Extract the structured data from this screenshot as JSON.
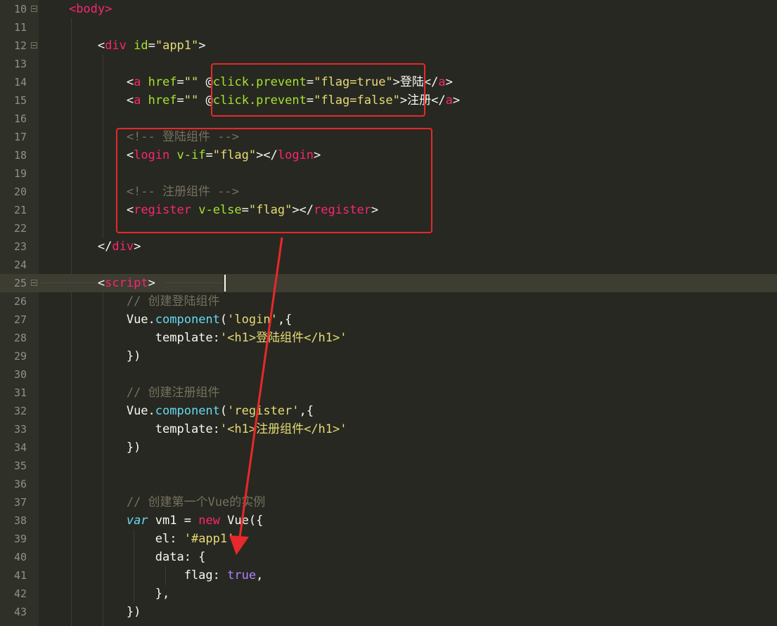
{
  "editor": {
    "lines": [
      {
        "n": "10",
        "fold": "open",
        "indent": "    ",
        "tokens": [
          [
            "tag",
            "<body>"
          ]
        ]
      },
      {
        "n": "11",
        "indent": "",
        "tokens": []
      },
      {
        "n": "12",
        "fold": "open",
        "indent": "        ",
        "tokens": [
          [
            "txt",
            "<"
          ],
          [
            "tag",
            "div"
          ],
          [
            "txt",
            " "
          ],
          [
            "attr",
            "id"
          ],
          [
            "txt",
            "="
          ],
          [
            "str",
            "\"app1\""
          ],
          [
            "txt",
            ">"
          ]
        ]
      },
      {
        "n": "13",
        "indent": "",
        "tokens": []
      },
      {
        "n": "14",
        "indent": "            ",
        "tokens": [
          [
            "txt",
            "<"
          ],
          [
            "tag",
            "a"
          ],
          [
            "txt",
            " "
          ],
          [
            "attr",
            "href"
          ],
          [
            "txt",
            "="
          ],
          [
            "str",
            "\"\""
          ],
          [
            "txt",
            " "
          ],
          [
            "txt",
            "@"
          ],
          [
            "attr",
            "click.prevent"
          ],
          [
            "txt",
            "="
          ],
          [
            "str",
            "\"flag=true\""
          ],
          [
            "txt",
            ">登陆</"
          ],
          [
            "tag",
            "a"
          ],
          [
            "txt",
            ">"
          ]
        ]
      },
      {
        "n": "15",
        "indent": "            ",
        "tokens": [
          [
            "txt",
            "<"
          ],
          [
            "tag",
            "a"
          ],
          [
            "txt",
            " "
          ],
          [
            "attr",
            "href"
          ],
          [
            "txt",
            "="
          ],
          [
            "str",
            "\"\""
          ],
          [
            "txt",
            " "
          ],
          [
            "txt",
            "@"
          ],
          [
            "attr",
            "click.prevent"
          ],
          [
            "txt",
            "="
          ],
          [
            "str",
            "\"flag=false\""
          ],
          [
            "txt",
            ">注册</"
          ],
          [
            "tag",
            "a"
          ],
          [
            "txt",
            ">"
          ]
        ]
      },
      {
        "n": "16",
        "indent": "",
        "tokens": []
      },
      {
        "n": "17",
        "indent": "            ",
        "tokens": [
          [
            "cmt",
            "<!-- 登陆组件 -->"
          ]
        ]
      },
      {
        "n": "18",
        "indent": "            ",
        "tokens": [
          [
            "txt",
            "<"
          ],
          [
            "tag",
            "login"
          ],
          [
            "txt",
            " "
          ],
          [
            "attr",
            "v-if"
          ],
          [
            "txt",
            "="
          ],
          [
            "str",
            "\"flag\""
          ],
          [
            "txt",
            "></"
          ],
          [
            "tag",
            "login"
          ],
          [
            "txt",
            ">"
          ]
        ]
      },
      {
        "n": "19",
        "indent": "",
        "tokens": []
      },
      {
        "n": "20",
        "indent": "            ",
        "tokens": [
          [
            "cmt",
            "<!-- 注册组件 -->"
          ]
        ]
      },
      {
        "n": "21",
        "indent": "            ",
        "tokens": [
          [
            "txt",
            "<"
          ],
          [
            "tag",
            "register"
          ],
          [
            "txt",
            " "
          ],
          [
            "attr",
            "v-else"
          ],
          [
            "txt",
            "="
          ],
          [
            "str",
            "\"flag\""
          ],
          [
            "txt",
            "></"
          ],
          [
            "tag",
            "register"
          ],
          [
            "txt",
            ">"
          ]
        ]
      },
      {
        "n": "22",
        "indent": "",
        "tokens": []
      },
      {
        "n": "23",
        "fold": "end",
        "indent": "        ",
        "tokens": [
          [
            "txt",
            "</"
          ],
          [
            "tag",
            "div"
          ],
          [
            "txt",
            ">"
          ]
        ]
      },
      {
        "n": "24",
        "indent": "",
        "tokens": []
      },
      {
        "n": "25",
        "fold": "open",
        "active": true,
        "indent": "        ",
        "tokens": [
          [
            "txt",
            "<"
          ],
          [
            "tag",
            "script"
          ],
          [
            "txt",
            ">"
          ]
        ]
      },
      {
        "n": "26",
        "indent": "            ",
        "tokens": [
          [
            "cmt",
            "// 创建登陆组件"
          ]
        ]
      },
      {
        "n": "27",
        "indent": "            ",
        "tokens": [
          [
            "txt",
            "Vue."
          ],
          [
            "fn",
            "component"
          ],
          [
            "txt",
            "("
          ],
          [
            "str",
            "'login'"
          ],
          [
            "txt",
            ",{"
          ]
        ]
      },
      {
        "n": "28",
        "indent": "                ",
        "tokens": [
          [
            "prop",
            "template"
          ],
          [
            "txt",
            ":"
          ],
          [
            "str",
            "'<h1>登陆组件</h1>'"
          ]
        ]
      },
      {
        "n": "29",
        "indent": "            ",
        "tokens": [
          [
            "txt",
            "})"
          ]
        ]
      },
      {
        "n": "30",
        "indent": "",
        "tokens": []
      },
      {
        "n": "31",
        "indent": "            ",
        "tokens": [
          [
            "cmt",
            "// 创建注册组件"
          ]
        ]
      },
      {
        "n": "32",
        "indent": "            ",
        "tokens": [
          [
            "txt",
            "Vue."
          ],
          [
            "fn",
            "component"
          ],
          [
            "txt",
            "("
          ],
          [
            "str",
            "'register'"
          ],
          [
            "txt",
            ",{"
          ]
        ]
      },
      {
        "n": "33",
        "indent": "                ",
        "tokens": [
          [
            "prop",
            "template"
          ],
          [
            "txt",
            ":"
          ],
          [
            "str",
            "'<h1>注册组件</h1>'"
          ]
        ]
      },
      {
        "n": "34",
        "indent": "            ",
        "tokens": [
          [
            "txt",
            "})"
          ]
        ]
      },
      {
        "n": "35",
        "indent": "",
        "tokens": []
      },
      {
        "n": "36",
        "indent": "",
        "tokens": []
      },
      {
        "n": "37",
        "indent": "            ",
        "tokens": [
          [
            "cmt",
            "// 创建第一个Vue的实例"
          ]
        ]
      },
      {
        "n": "38",
        "indent": "            ",
        "tokens": [
          [
            "kw",
            "var"
          ],
          [
            "txt",
            " vm1 = "
          ],
          [
            "new",
            "new"
          ],
          [
            "txt",
            " Vue({"
          ]
        ]
      },
      {
        "n": "39",
        "indent": "                ",
        "tokens": [
          [
            "txt",
            "el: "
          ],
          [
            "str",
            "'#app1'"
          ],
          [
            "txt",
            ","
          ]
        ]
      },
      {
        "n": "40",
        "indent": "                ",
        "tokens": [
          [
            "txt",
            "data: {"
          ]
        ]
      },
      {
        "n": "41",
        "indent": "                    ",
        "tokens": [
          [
            "txt",
            "flag: "
          ],
          [
            "bool",
            "true"
          ],
          [
            "txt",
            ","
          ]
        ]
      },
      {
        "n": "42",
        "indent": "                ",
        "tokens": [
          [
            "txt",
            "},"
          ]
        ]
      },
      {
        "n": "43",
        "indent": "            ",
        "tokens": [
          [
            "txt",
            "})"
          ]
        ]
      }
    ]
  },
  "annotations": {
    "highlight_color": "#e8282a",
    "arrow_color": "#e8282a"
  },
  "theme": {
    "background": "#272822",
    "gutter": "#2f3129",
    "active_line": "#3e3d32"
  }
}
